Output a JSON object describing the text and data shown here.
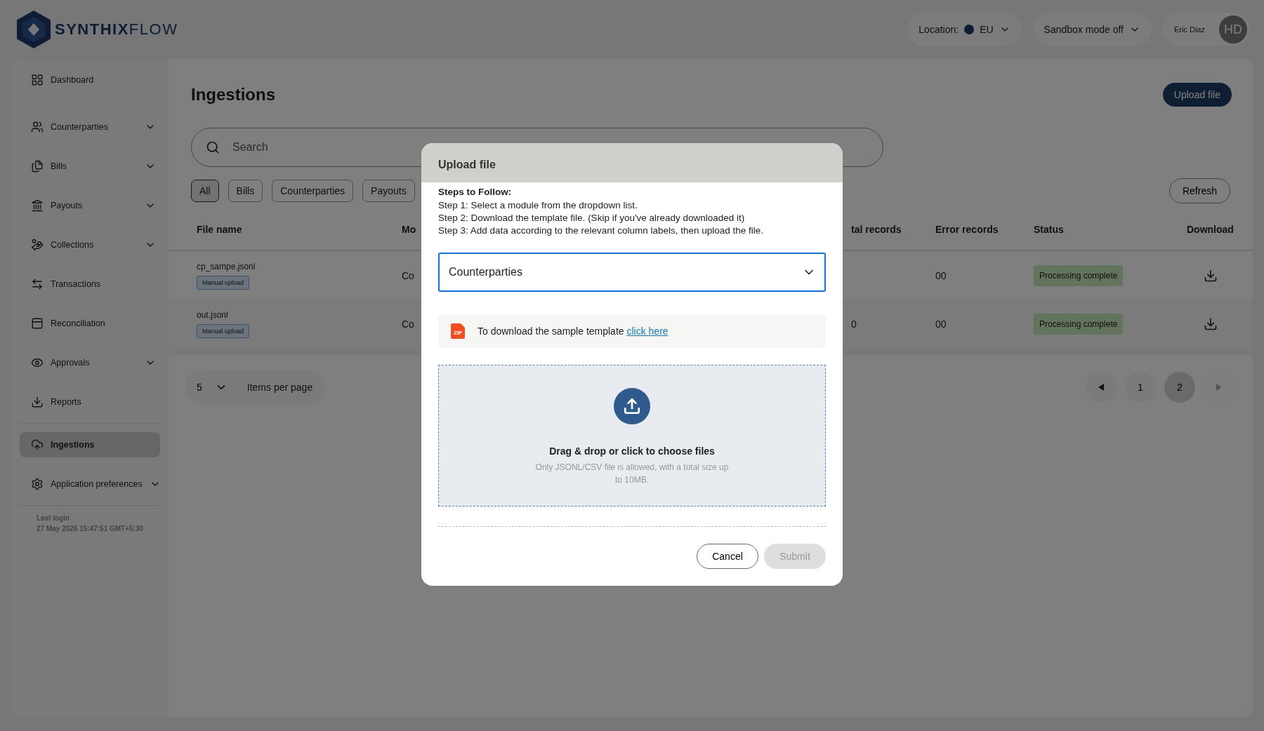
{
  "brand": {
    "name": "**SYNTHIX**FLOW"
  },
  "header": {
    "location_label": "Location:",
    "location_value": "EU",
    "sandbox": "Sandbox mode off",
    "user_name": "Eric Diaz",
    "avatar_initials": "HD"
  },
  "sidebar": {
    "sections": [
      {
        "items": [
          {
            "label": "Dashboard",
            "expandable": false,
            "selected": false
          },
          {
            "label": "Counterparties",
            "expandable": true,
            "selected": false
          },
          {
            "label": "Bills",
            "expandable": true,
            "selected": false
          },
          {
            "label": "Payouts",
            "expandable": true,
            "selected": false
          },
          {
            "label": "Collections",
            "expandable": true,
            "selected": false
          },
          {
            "label": "Transactions",
            "expandable": false,
            "selected": false
          },
          {
            "label": "Reconciliation",
            "expandable": false,
            "selected": false
          },
          {
            "label": "Approvals",
            "expandable": true,
            "selected": false
          },
          {
            "label": "Reports",
            "expandable": false,
            "selected": false
          }
        ]
      },
      {
        "items": [
          {
            "label": "Ingestions",
            "expandable": false,
            "selected": true
          },
          {
            "label": "Application preferences",
            "expandable": true,
            "selected": false
          }
        ]
      }
    ],
    "last_login_label": "Last login",
    "last_login_time": "27 May 2026 15:47:51 GMT+5:30"
  },
  "page": {
    "title": "Ingestions",
    "upload_button": "Upload file",
    "search_placeholder": "Search",
    "refresh_button": "Refresh",
    "filters": [
      {
        "label": "All",
        "selected": true
      },
      {
        "label": "Bills",
        "selected": false
      },
      {
        "label": "Counterparties",
        "selected": false
      },
      {
        "label": "Payouts",
        "selected": false
      }
    ]
  },
  "table": {
    "columns": [
      "File name",
      "Mo",
      "tal records",
      "Error records",
      "Status",
      "Download"
    ],
    "rows": [
      {
        "file_name": "cp_sampe.jsonl",
        "tag": "Manual upload",
        "module": "Co",
        "error_records": "00",
        "status": "Processing complete"
      },
      {
        "file_name": "out.jsonl",
        "tag": "Manual upload",
        "module": "Co",
        "total_records": "0",
        "error_records": "00",
        "status": "Processing complete"
      }
    ]
  },
  "pagination": {
    "per_page": "5",
    "per_page_label": "Items per page",
    "pages": [
      {
        "label": "1",
        "selected": false
      },
      {
        "label": "2",
        "selected": true
      }
    ]
  },
  "modal": {
    "title": "Upload file",
    "steps_title": "Steps to Follow:",
    "steps": [
      "Step 1: Select a module from the dropdown list.",
      "Step 2: Download the template file. (Skip if you've already downloaded it)",
      "Step 3: Add data according to the relevant column labels, then upload the file."
    ],
    "module_select": "Counterparties",
    "zip_label": "ZIP",
    "template_text": "To download the sample template",
    "template_link": "click here",
    "drop_title": "Drag & drop or click to choose files",
    "drop_hint": "Only JSONL/CSV file is allowed, with a total size up to 10MB.",
    "cancel_button": "Cancel",
    "submit_button": {
      "label": "Submit",
      "disabled": true
    }
  }
}
